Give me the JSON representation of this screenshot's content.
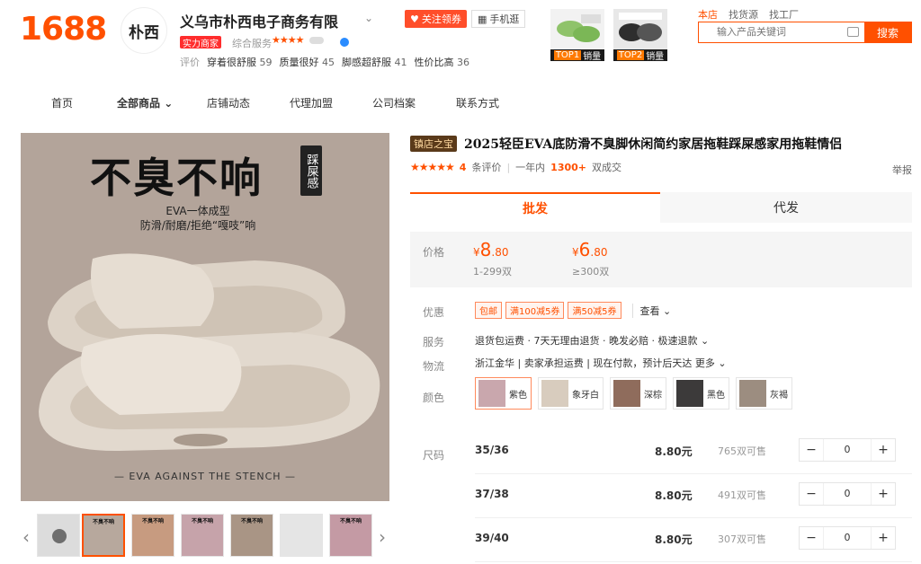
{
  "logo": "1688",
  "shop": {
    "avatar_text": "朴西",
    "name": "义乌市朴西电子商务有限",
    "follow_label": "关注领券",
    "mobile_label": "手机逛",
    "badge": "实力商家",
    "service_label": "综合服务",
    "service_stars": "★★★★",
    "eval_label": "评价",
    "eval_tags": [
      {
        "text": "穿着很舒服",
        "count": "59"
      },
      {
        "text": "质量很好",
        "count": "45"
      },
      {
        "text": "脚感超舒服",
        "count": "41"
      },
      {
        "text": "性价比高",
        "count": "36"
      }
    ]
  },
  "top_sales": [
    {
      "rank": "TOP1",
      "label": "销量"
    },
    {
      "rank": "TOP2",
      "label": "销量"
    }
  ],
  "search": {
    "tabs": [
      "本店",
      "找货源",
      "找工厂"
    ],
    "placeholder": "输入产品关键词",
    "button": "搜索"
  },
  "nav": [
    "首页",
    "全部商品",
    "店铺动态",
    "代理加盟",
    "公司档案",
    "联系方式"
  ],
  "gallery": {
    "headline": "不臭不响",
    "badge": "踩屎感",
    "sub1": "EVA一体成型",
    "sub2": "防滑/耐磨/拒绝“嘎吱”响",
    "caption": "— EVA AGAINST THE STENCH —",
    "thumb_text": "不臭不响"
  },
  "product": {
    "tag": "镇店之宝",
    "title": "2025轻臣EVA底防滑不臭脚休闲简约家居拖鞋踩屎感家用拖鞋情侣",
    "stars": "★★★★★",
    "rating": "4",
    "review_label": "条评价",
    "year_label": "一年内",
    "sold": "1300+",
    "sold_label": "双成交",
    "report": "举报"
  },
  "tabs": [
    "批发",
    "代发"
  ],
  "price": {
    "label": "价格",
    "tiers": [
      {
        "symbol": "¥",
        "int": "8",
        "dec": ".80",
        "range": "1-299双"
      },
      {
        "symbol": "¥",
        "int": "6",
        "dec": ".80",
        "range": "≥300双"
      }
    ]
  },
  "labels": {
    "promo": "优惠",
    "service": "服务",
    "logistics": "物流",
    "color": "颜色",
    "size": "尺码"
  },
  "coupons": [
    "包邮",
    "满100减5券",
    "满50减5券"
  ],
  "view_label": "查看",
  "service_text": "退货包运费 · 7天无理由退货 · 晚发必赔 · 极速退款",
  "logistics_text": "浙江金华 | 卖家承担运费 | 现在付款，预计后天达 更多",
  "colors": [
    {
      "name": "紫色",
      "swatch": "#c9a7ad"
    },
    {
      "name": "象牙白",
      "swatch": "#d8ccbe"
    },
    {
      "name": "深棕",
      "swatch": "#8f6c5c"
    },
    {
      "name": "黑色",
      "swatch": "#3c3a3a"
    },
    {
      "name": "灰褐",
      "swatch": "#9c8d80"
    }
  ],
  "sizes": [
    {
      "name": "35/36",
      "price": "8.80元",
      "stock": "765双可售",
      "qty": "0"
    },
    {
      "name": "37/38",
      "price": "8.80元",
      "stock": "491双可售",
      "qty": "0"
    },
    {
      "name": "39/40",
      "price": "8.80元",
      "stock": "307双可售",
      "qty": "0"
    }
  ],
  "brand_color": "#ff5000"
}
